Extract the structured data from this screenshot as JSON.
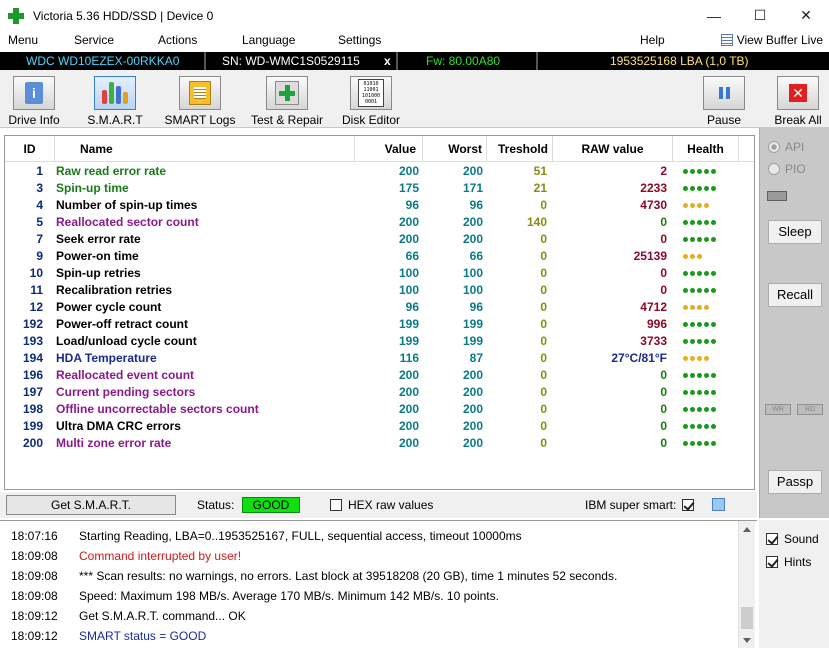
{
  "window": {
    "title": "Victoria 5.36 HDD/SSD | Device 0",
    "minimize": "—",
    "maximize": "☐",
    "close": "✕"
  },
  "menu": {
    "items": [
      "Menu",
      "Service",
      "Actions",
      "Language",
      "Settings",
      "Help"
    ],
    "view_buffer": "View Buffer Live"
  },
  "device": {
    "model": "WDC WD10EZEX-00RKKA0",
    "serial": "SN: WD-WMC1S0529115",
    "eject": "x",
    "firmware": "Fw: 80.00A80",
    "lba": "1953525168 LBA (1,0 TB)"
  },
  "toolbar": {
    "drive_info": "Drive Info",
    "smart": "S.M.A.R.T",
    "smart_logs": "SMART Logs",
    "test_repair": "Test & Repair",
    "disk_editor": "Disk Editor",
    "pause": "Pause",
    "break_all": "Break All",
    "editor_glyph": "01010\n11001\n101000\n0001"
  },
  "table": {
    "headers": [
      "ID",
      "Name",
      "Value",
      "Worst",
      "Treshold",
      "RAW value",
      "Health"
    ],
    "rows": [
      {
        "id": "1",
        "name": "Raw read error rate",
        "value": "200",
        "worst": "200",
        "thr": "51",
        "raw": "2",
        "health": 5,
        "name_color": "#1a7a1a",
        "raw_color": "#8a0a2a",
        "thr_color": "#8a8a10",
        "health_color": "#1a9a1a"
      },
      {
        "id": "3",
        "name": "Spin-up time",
        "value": "175",
        "worst": "171",
        "thr": "21",
        "raw": "2233",
        "health": 5,
        "name_color": "#1a7a1a",
        "raw_color": "#8a0a2a",
        "thr_color": "#8a8a10",
        "health_color": "#1a9a1a"
      },
      {
        "id": "4",
        "name": "Number of spin-up times",
        "value": "96",
        "worst": "96",
        "thr": "0",
        "raw": "4730",
        "health": 4,
        "name_color": "#000000",
        "raw_color": "#8a0a2a",
        "thr_color": "#8a8a10",
        "health_color": "#e0b020"
      },
      {
        "id": "5",
        "name": "Reallocated sector count",
        "value": "200",
        "worst": "200",
        "thr": "140",
        "raw": "0",
        "health": 5,
        "name_color": "#8a1a8a",
        "raw_color": "#1a7a1a",
        "thr_color": "#8a8a10",
        "health_color": "#1a9a1a"
      },
      {
        "id": "7",
        "name": "Seek error rate",
        "value": "200",
        "worst": "200",
        "thr": "0",
        "raw": "0",
        "health": 5,
        "name_color": "#000000",
        "raw_color": "#8a0a2a",
        "thr_color": "#8a8a10",
        "health_color": "#1a9a1a"
      },
      {
        "id": "9",
        "name": "Power-on time",
        "value": "66",
        "worst": "66",
        "thr": "0",
        "raw": "25139",
        "health": 3,
        "name_color": "#000000",
        "raw_color": "#8a0a2a",
        "thr_color": "#8a8a10",
        "health_color": "#e0b020"
      },
      {
        "id": "10",
        "name": "Spin-up retries",
        "value": "100",
        "worst": "100",
        "thr": "0",
        "raw": "0",
        "health": 5,
        "name_color": "#000000",
        "raw_color": "#8a0a2a",
        "thr_color": "#8a8a10",
        "health_color": "#1a9a1a"
      },
      {
        "id": "11",
        "name": "Recalibration retries",
        "value": "100",
        "worst": "100",
        "thr": "0",
        "raw": "0",
        "health": 5,
        "name_color": "#000000",
        "raw_color": "#8a0a2a",
        "thr_color": "#8a8a10",
        "health_color": "#1a9a1a"
      },
      {
        "id": "12",
        "name": "Power cycle count",
        "value": "96",
        "worst": "96",
        "thr": "0",
        "raw": "4712",
        "health": 4,
        "name_color": "#000000",
        "raw_color": "#8a0a2a",
        "thr_color": "#8a8a10",
        "health_color": "#e0b020"
      },
      {
        "id": "192",
        "name": "Power-off retract count",
        "value": "199",
        "worst": "199",
        "thr": "0",
        "raw": "996",
        "health": 5,
        "name_color": "#000000",
        "raw_color": "#8a0a2a",
        "thr_color": "#8a8a10",
        "health_color": "#1a9a1a"
      },
      {
        "id": "193",
        "name": "Load/unload cycle count",
        "value": "199",
        "worst": "199",
        "thr": "0",
        "raw": "3733",
        "health": 5,
        "name_color": "#000000",
        "raw_color": "#8a0a2a",
        "thr_color": "#8a8a10",
        "health_color": "#1a9a1a"
      },
      {
        "id": "194",
        "name": "HDA Temperature",
        "value": "116",
        "worst": "87",
        "thr": "0",
        "raw": "27°C/81°F",
        "health": 4,
        "name_color": "#1a2a8a",
        "raw_color": "#1a2a8a",
        "thr_color": "#8a8a10",
        "health_color": "#e0b020"
      },
      {
        "id": "196",
        "name": "Reallocated event count",
        "value": "200",
        "worst": "200",
        "thr": "0",
        "raw": "0",
        "health": 5,
        "name_color": "#8a1a8a",
        "raw_color": "#1a7a1a",
        "thr_color": "#8a8a10",
        "health_color": "#1a9a1a"
      },
      {
        "id": "197",
        "name": "Current pending sectors",
        "value": "200",
        "worst": "200",
        "thr": "0",
        "raw": "0",
        "health": 5,
        "name_color": "#8a1a8a",
        "raw_color": "#1a7a1a",
        "thr_color": "#8a8a10",
        "health_color": "#1a9a1a"
      },
      {
        "id": "198",
        "name": "Offline uncorrectable sectors count",
        "value": "200",
        "worst": "200",
        "thr": "0",
        "raw": "0",
        "health": 5,
        "name_color": "#8a1a8a",
        "raw_color": "#1a7a1a",
        "thr_color": "#8a8a10",
        "health_color": "#1a9a1a"
      },
      {
        "id": "199",
        "name": "Ultra DMA CRC errors",
        "value": "200",
        "worst": "200",
        "thr": "0",
        "raw": "0",
        "health": 5,
        "name_color": "#000000",
        "raw_color": "#1a7a1a",
        "thr_color": "#8a8a10",
        "health_color": "#1a9a1a"
      },
      {
        "id": "200",
        "name": "Multi zone error rate",
        "value": "200",
        "worst": "200",
        "thr": "0",
        "raw": "0",
        "health": 5,
        "name_color": "#8a1a8a",
        "raw_color": "#1a7a1a",
        "thr_color": "#8a8a10",
        "health_color": "#1a9a1a"
      }
    ]
  },
  "side": {
    "api": "API",
    "pio": "PIO",
    "sleep": "Sleep",
    "recall": "Recall",
    "wr": "WR",
    "rd": "RD",
    "passp": "Passp"
  },
  "statusbar": {
    "get_smart": "Get S.M.A.R.T.",
    "status_label": "Status:",
    "status_value": "GOOD",
    "hex_raw": "HEX raw values",
    "ibm_super_smart": "IBM super smart:"
  },
  "log": [
    {
      "time": "18:07:16",
      "msg": "Starting Reading, LBA=0..1953525167, FULL, sequential access, timeout 10000ms",
      "color": "#000000"
    },
    {
      "time": "18:09:08",
      "msg": "Command interrupted by user!",
      "color": "#d01818"
    },
    {
      "time": "18:09:08",
      "msg": "*** Scan results: no warnings, no errors. Last block at 39518208 (20 GB), time 1 minutes 52 seconds.",
      "color": "#000000"
    },
    {
      "time": "18:09:08",
      "msg": "Speed: Maximum 198 MB/s. Average 170 MB/s. Minimum 142 MB/s. 10 points.",
      "color": "#000000"
    },
    {
      "time": "18:09:12",
      "msg": "Get S.M.A.R.T. command... OK",
      "color": "#000000"
    },
    {
      "time": "18:09:12",
      "msg": "SMART status = GOOD",
      "color": "#1a2a9a"
    }
  ],
  "options": {
    "sound": "Sound",
    "hints": "Hints"
  }
}
